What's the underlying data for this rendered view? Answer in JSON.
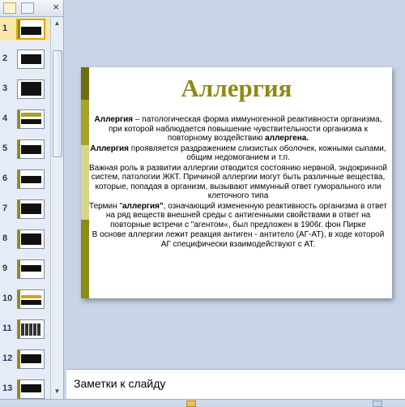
{
  "thumbnails": [
    {
      "num": "1"
    },
    {
      "num": "2"
    },
    {
      "num": "3"
    },
    {
      "num": "4"
    },
    {
      "num": "5"
    },
    {
      "num": "6"
    },
    {
      "num": "7"
    },
    {
      "num": "8"
    },
    {
      "num": "9"
    },
    {
      "num": "10"
    },
    {
      "num": "11"
    },
    {
      "num": "12"
    },
    {
      "num": "13"
    }
  ],
  "panel": {
    "close_glyph": "×"
  },
  "slide": {
    "title": "Аллергия",
    "p1_bold": "Аллергия",
    "p1_rest": " – патологическая форма иммуногенной реактивности организма,  при которой наблюдается повышение чувствительности организма к повторному воздействию ",
    "p1_end": "аллергена.",
    "p2_bold": "Аллергия",
    "p2_rest": " проявляется  раздражением слизистых оболочек, кожными сыпами, общим недомоганием и т.п.",
    "p3": "Важная роль в развитии аллергии отводится состоянию нервной, эндокринной систем, патологии ЖКТ. Причиной аллергии могут быть различные вещества, которые, попадая в организм, вызывают иммунный ответ гуморального или клеточного типа",
    "p4_start": "Термин \"",
    "p4_bold": "аллергия\"",
    "p4_rest": ", означающий измененную реактивность организма в ответ на ряд веществ внешней среды с антигенными свойствами в ответ на повторные встречи с \"агентом«, был предложен в 1906г. фон Пирке",
    "p5": "В основе аллергии лежит реакция антиген - антитело (АГ-АТ), в ходе которой АГ специфически взаимодействуют с АТ."
  },
  "notes": {
    "placeholder": "Заметки к слайду"
  },
  "colors": {
    "accent": "#8d8a16",
    "strip_dark": "#6f6b0f",
    "strip_light": "#d8d58a",
    "selection": "#e1a40c"
  }
}
